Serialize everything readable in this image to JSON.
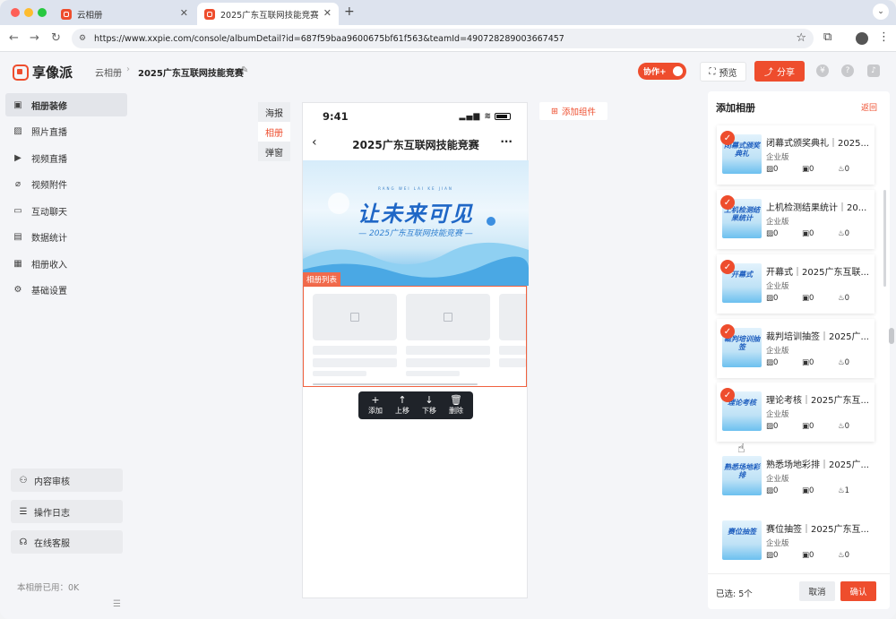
{
  "browser": {
    "tabs": [
      {
        "title": "云相册"
      },
      {
        "title": "2025广东互联网技能竞赛"
      }
    ],
    "url": "https://www.xxpie.com/console/albumDetail?id=687f59baa9600675bf61f563&teamId=490728289003667457"
  },
  "header": {
    "logo": "享像派",
    "breadcrumb_root": "云相册",
    "breadcrumb_current": "2025广东互联网技能竞赛",
    "collab_label": "协作+",
    "preview_label": "预览",
    "share_label": "分享"
  },
  "sidebar": {
    "items": [
      {
        "label": "相册装修",
        "icon": "layout-icon"
      },
      {
        "label": "照片直播",
        "icon": "image-icon"
      },
      {
        "label": "视频直播",
        "icon": "video-icon"
      },
      {
        "label": "视频附件",
        "icon": "paperclip-icon"
      },
      {
        "label": "互动聊天",
        "icon": "chat-icon"
      },
      {
        "label": "数据统计",
        "icon": "chart-icon"
      },
      {
        "label": "相册收入",
        "icon": "wallet-icon"
      },
      {
        "label": "基础设置",
        "icon": "gear-icon"
      }
    ],
    "bottom": [
      {
        "label": "内容审核",
        "icon": "user-icon"
      },
      {
        "label": "操作日志",
        "icon": "document-icon"
      },
      {
        "label": "在线客服",
        "icon": "headset-icon"
      }
    ],
    "usage": "本相册已用：0K"
  },
  "page_tabs": [
    "海报",
    "相册",
    "弹窗"
  ],
  "phone": {
    "time": "9:41",
    "title": "2025广东互联网技能竞赛",
    "banner_title": "让未来可见",
    "banner_subtitle": "— 2025广东互联网技能竞赛 —",
    "banner_tiny": "RANG WEI LAI KE JIAN",
    "list_label": "相册列表"
  },
  "component_toolbar": [
    {
      "icon": "+",
      "label": "添加"
    },
    {
      "icon": "↑",
      "label": "上移"
    },
    {
      "icon": "↓",
      "label": "下移"
    },
    {
      "icon": "🗑",
      "label": "删除"
    }
  ],
  "add_component": "添加组件",
  "panel": {
    "title": "添加相册",
    "back": "返回",
    "albums": [
      {
        "name": "闭幕式颁奖典礼｜2025...",
        "type": "企业版",
        "thumb": "闭幕式颁奖典礼",
        "photos": "0",
        "videos": "0",
        "likes": "0",
        "selected": true
      },
      {
        "name": "上机检测结果统计｜20...",
        "type": "企业版",
        "thumb": "上机检测结果统计",
        "photos": "0",
        "videos": "0",
        "likes": "0",
        "selected": true
      },
      {
        "name": "开幕式｜2025广东互联...",
        "type": "企业版",
        "thumb": "开幕式",
        "photos": "0",
        "videos": "0",
        "likes": "0",
        "selected": true
      },
      {
        "name": "裁判培训抽签｜2025广...",
        "type": "企业版",
        "thumb": "裁判培训抽签",
        "photos": "0",
        "videos": "0",
        "likes": "0",
        "selected": true
      },
      {
        "name": "理论考核｜2025广东互...",
        "type": "企业版",
        "thumb": "理论考核",
        "photos": "0",
        "videos": "0",
        "likes": "0",
        "selected": true
      },
      {
        "name": "熟悉场地彩排｜2025广...",
        "type": "企业版",
        "thumb": "熟悉场地彩排",
        "photos": "0",
        "videos": "0",
        "likes": "1",
        "selected": false
      },
      {
        "name": "赛位抽签｜2025广东互...",
        "type": "企业版",
        "thumb": "赛位抽签",
        "photos": "0",
        "videos": "0",
        "likes": "0",
        "selected": false
      }
    ],
    "selected_label": "已选: 5个",
    "cancel": "取消",
    "confirm": "确认"
  },
  "colors": {
    "accent": "#ee4d2d"
  }
}
